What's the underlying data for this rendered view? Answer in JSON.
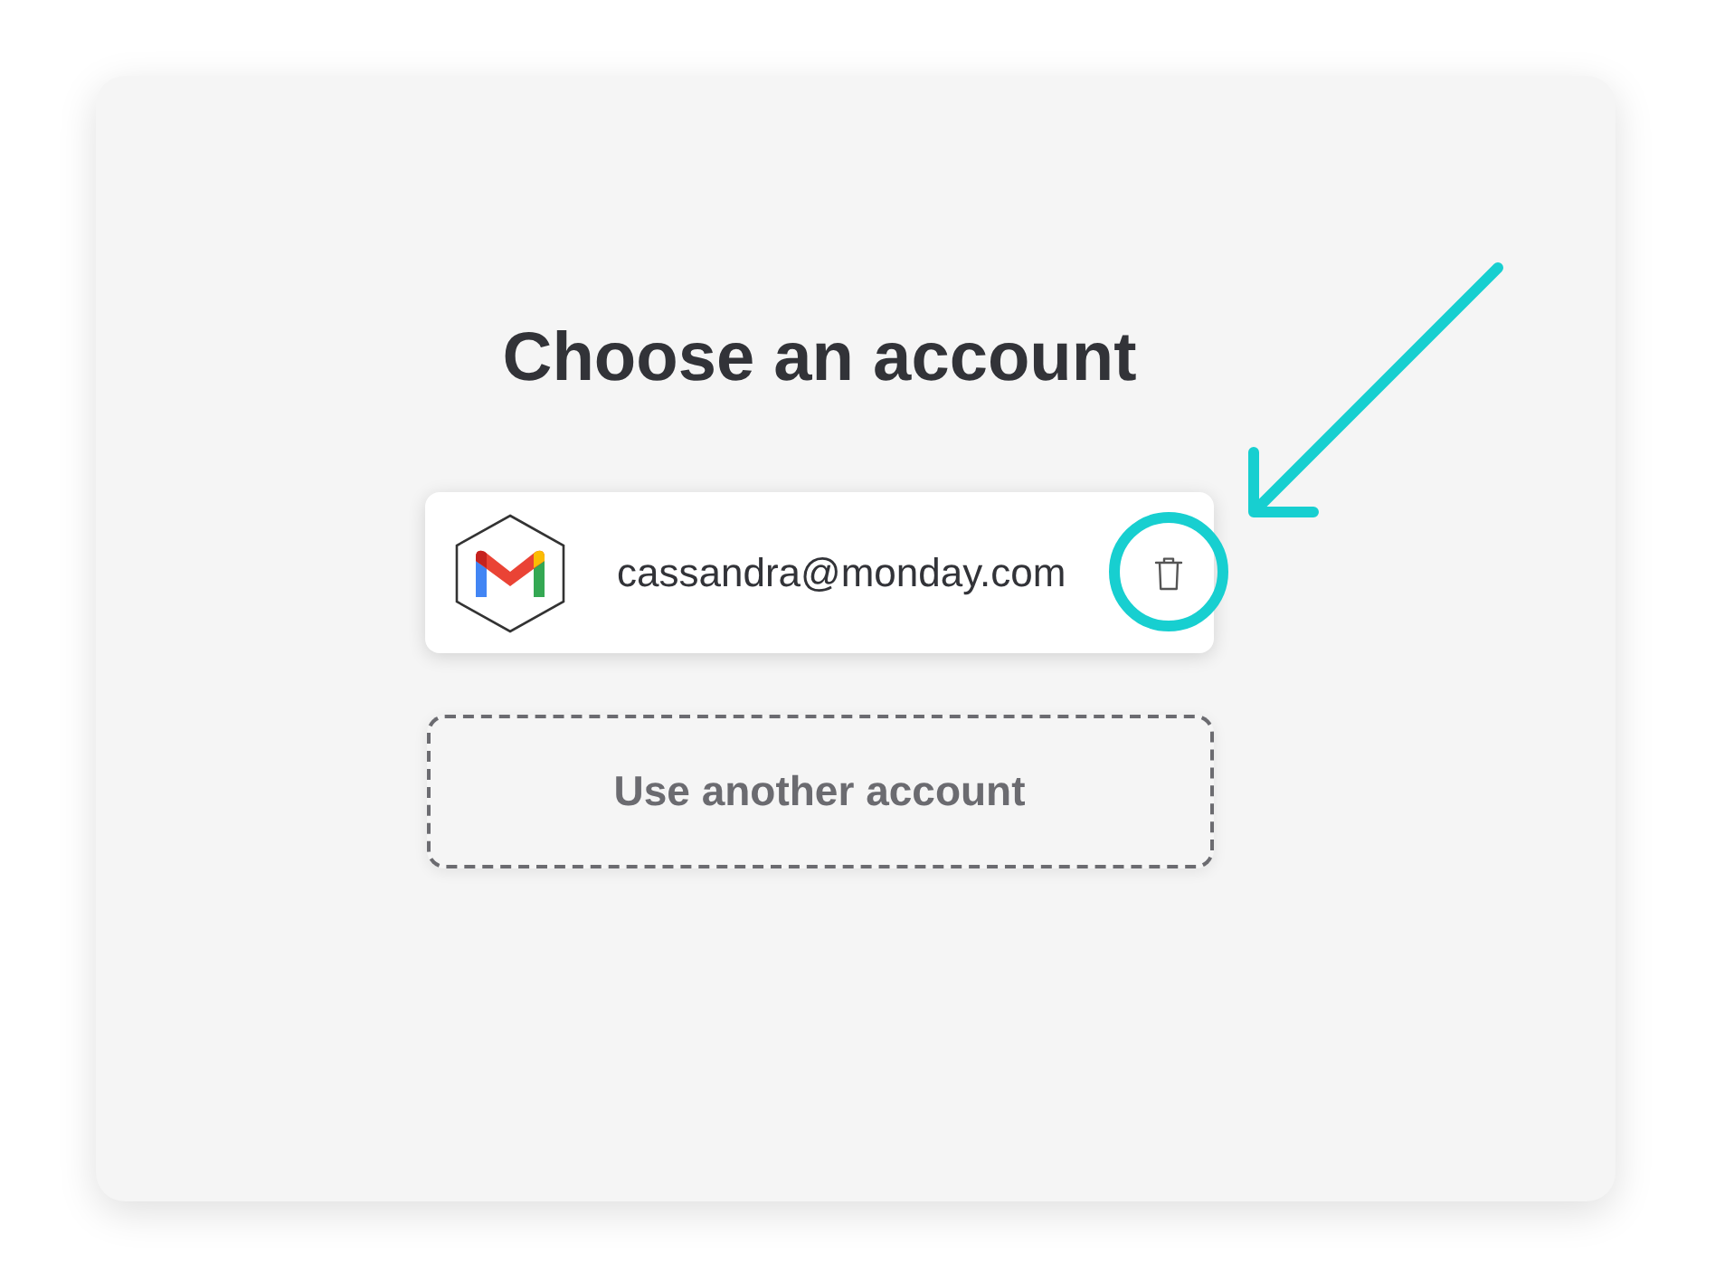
{
  "title": "Choose an account",
  "accounts": [
    {
      "email": "cassandra@monday.com",
      "delete_callout": true
    }
  ],
  "other_account_button": "Use another account"
}
